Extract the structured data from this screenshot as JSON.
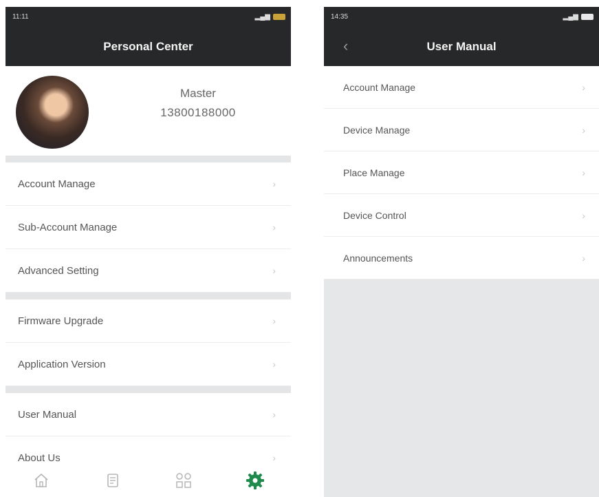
{
  "left": {
    "status_time": "11:11",
    "title": "Personal Center",
    "profile": {
      "name": "Master",
      "phone": "13800188000"
    },
    "groups": [
      [
        "Account Manage",
        "Sub-Account Manage",
        "Advanced Setting"
      ],
      [
        "Firmware Upgrade",
        "Application Version"
      ],
      [
        "User Manual",
        "About Us"
      ]
    ],
    "tabs": [
      "home-icon",
      "document-icon",
      "grid-icon",
      "settings-icon"
    ],
    "accent_color": "#1f8a4c"
  },
  "right": {
    "status_time": "14:35",
    "title": "User Manual",
    "items": [
      "Account Manage",
      "Device Manage",
      "Place Manage",
      "Device Control",
      "Announcements"
    ]
  }
}
